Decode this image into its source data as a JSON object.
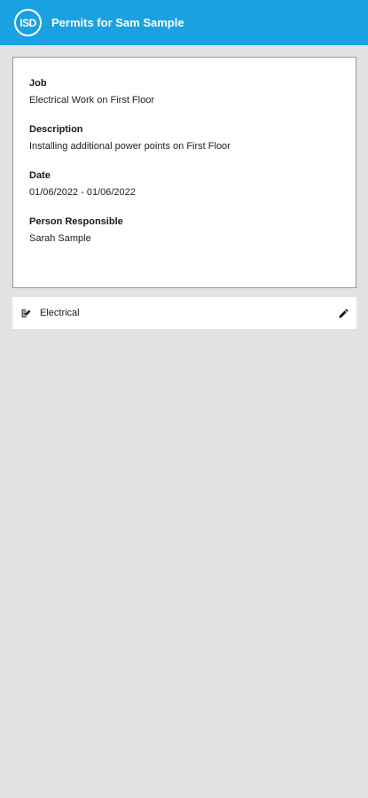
{
  "header": {
    "logo_text": "ISD",
    "title": "Permits for Sam Sample",
    "background_color": "#1aa1e1"
  },
  "details": {
    "job_label": "Job",
    "job_value": "Electrical Work on First Floor",
    "description_label": "Description",
    "description_value": "Installing additional power points on First Floor",
    "date_label": "Date",
    "date_value": "01/06/2022 - 01/06/2022",
    "person_label": "Person Responsible",
    "person_value": "Sarah Sample"
  },
  "permits": [
    {
      "label": "Electrical",
      "icon": "permit-document-edit-icon",
      "action_icon": "pencil-edit-icon"
    }
  ]
}
